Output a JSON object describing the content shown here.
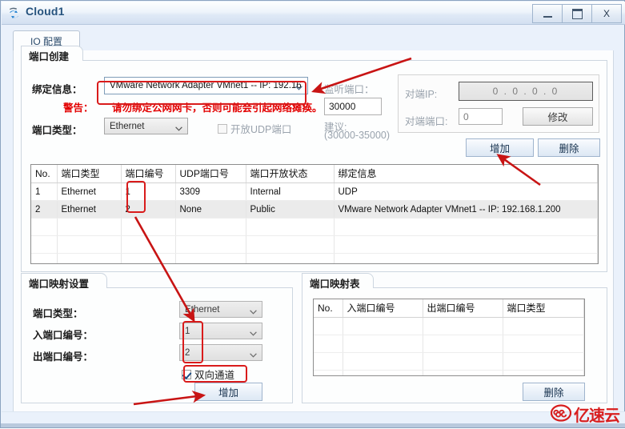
{
  "window": {
    "title": "Cloud1",
    "icon": "cloud-device-icon",
    "minimize_label": "_",
    "maximize_label": "□",
    "close_label": "X"
  },
  "tabs": [
    {
      "label": "IO 配置",
      "name": "tab-io-config",
      "active": true
    }
  ],
  "port_create": {
    "title": "端口创建",
    "binding_label": "绑定信息：",
    "binding_value": "VMware Network Adapter VMnet1 -- IP: 192.16",
    "warning_label": "警告：",
    "warning_text": "请勿绑定公网网卡，否则可能会引起网络瘫痪。",
    "port_type_label": "端口类型：",
    "port_type_value": "Ethernet",
    "udp_checkbox_label": "开放UDP端口",
    "udp_checked": false,
    "listen_port_label": "监听端口：",
    "listen_port_value": "30000",
    "suggest_label": "建议:",
    "suggest_range": "(30000-35000)",
    "peer_ip_label": "对端IP:",
    "peer_ip_value": "0  .  0  .  0  .  0",
    "peer_port_label": "对端端口:",
    "peer_port_value": "0",
    "modify_button": "修改",
    "add_button": "增加",
    "delete_button": "删除"
  },
  "port_table": {
    "headers": [
      "No.",
      "端口类型",
      "端口编号",
      "UDP端口号",
      "端口开放状态",
      "绑定信息"
    ],
    "rows": [
      [
        "1",
        "Ethernet",
        "1",
        "3309",
        "Internal",
        "UDP"
      ],
      [
        "2",
        "Ethernet",
        "2",
        "None",
        "Public",
        "VMware Network Adapter VMnet1 -- IP: 192.168.1.200"
      ]
    ],
    "empty_row_count": 5
  },
  "port_mapping_settings": {
    "title": "端口映射设置",
    "port_type_label": "端口类型：",
    "port_type_value": "Ethernet",
    "in_port_label": "入端口编号：",
    "in_port_value": "1",
    "out_port_label": "出端口编号：",
    "out_port_value": "2",
    "bidirectional_label": "双向通道",
    "bidirectional_checked": true,
    "add_button": "增加"
  },
  "port_mapping_table": {
    "title": "端口映射表",
    "headers": [
      "No.",
      "入端口编号",
      "出端口编号",
      "端口类型"
    ],
    "rows": [],
    "empty_row_count": 5,
    "delete_button": "删除"
  },
  "watermark": {
    "text": "亿速云",
    "icon": "cloud-logo-icon"
  },
  "colors": {
    "annotation": "#d91b1b",
    "warning": "#e30000",
    "title_text": "#26537e",
    "accent": "#7f9db9"
  }
}
